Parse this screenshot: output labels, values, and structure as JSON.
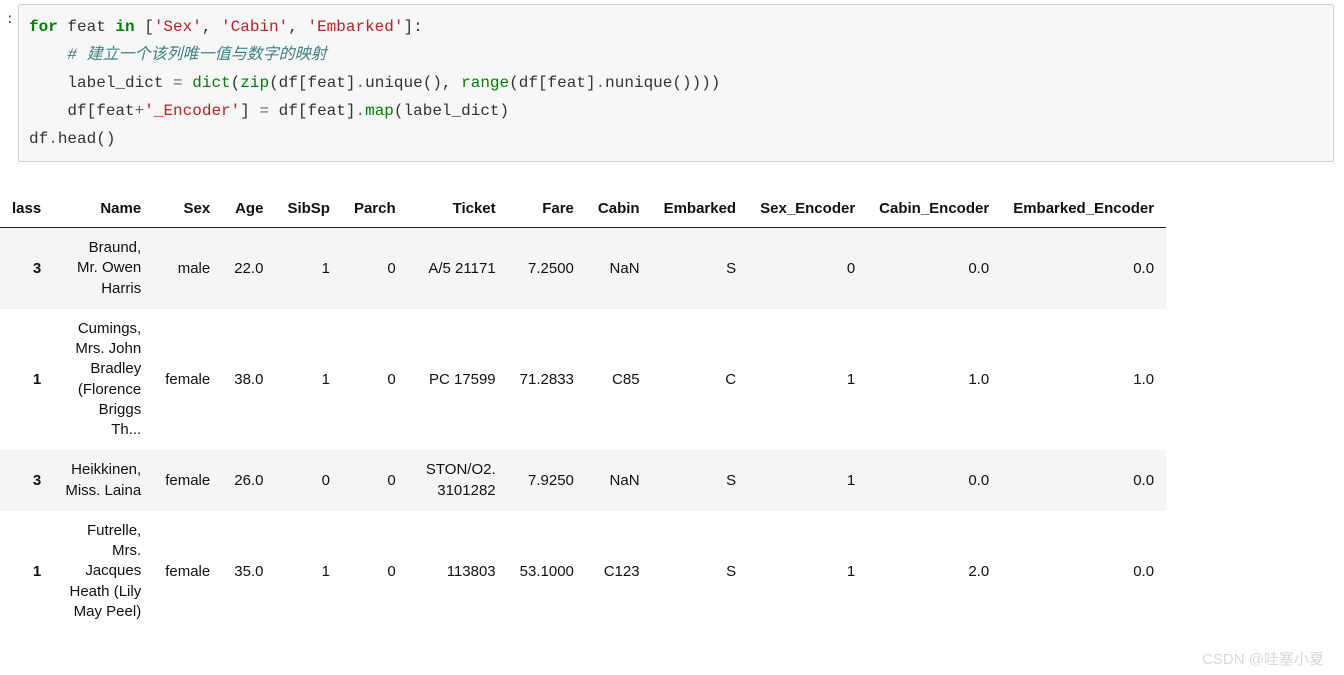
{
  "prompt": ":",
  "code": {
    "line1_for": "for",
    "line1_var": " feat ",
    "line1_in": "in",
    "line1_open": " [",
    "line1_s1": "'Sex'",
    "line1_c1": ", ",
    "line1_s2": "'Cabin'",
    "line1_c2": ", ",
    "line1_s3": "'Embarked'",
    "line1_close": "]:",
    "line2_indent": "    ",
    "line2_comment": "# 建立一个该列唯一值与数字的映射",
    "line3_indent": "    ",
    "line3_a": "label_dict ",
    "line3_eq": "=",
    "line3_b": " ",
    "line3_dict": "dict",
    "line3_p1": "(",
    "line3_zip": "zip",
    "line3_p2": "(df[feat]",
    "line3_dot1": ".",
    "line3_uniq": "unique(), ",
    "line3_range": "range",
    "line3_p3": "(df[feat]",
    "line3_dot2": ".",
    "line3_nun": "nunique())))",
    "line4_indent": "    ",
    "line4_a": "df[feat",
    "line4_plus": "+",
    "line4_str": "'_Encoder'",
    "line4_b": "] ",
    "line4_eq": "=",
    "line4_c": " df[feat]",
    "line4_dot": ".",
    "line4_map": "map",
    "line4_d": "(label_dict)",
    "line5_a": "df",
    "line5_dot": ".",
    "line5_head": "head",
    "line5_p": "()"
  },
  "table": {
    "headers": [
      "lass",
      "Name",
      "Sex",
      "Age",
      "SibSp",
      "Parch",
      "Ticket",
      "Fare",
      "Cabin",
      "Embarked",
      "Sex_Encoder",
      "Cabin_Encoder",
      "Embarked_Encoder"
    ],
    "rows": [
      {
        "lass": "3",
        "Name": "Braund, Mr. Owen Harris",
        "Sex": "male",
        "Age": "22.0",
        "SibSp": "1",
        "Parch": "0",
        "Ticket": "A/5 21171",
        "Fare": "7.2500",
        "Cabin": "NaN",
        "Embarked": "S",
        "Sex_Encoder": "0",
        "Cabin_Encoder": "0.0",
        "Embarked_Encoder": "0.0"
      },
      {
        "lass": "1",
        "Name": "Cumings, Mrs. John Bradley (Florence Briggs Th...",
        "Sex": "female",
        "Age": "38.0",
        "SibSp": "1",
        "Parch": "0",
        "Ticket": "PC 17599",
        "Fare": "71.2833",
        "Cabin": "C85",
        "Embarked": "C",
        "Sex_Encoder": "1",
        "Cabin_Encoder": "1.0",
        "Embarked_Encoder": "1.0"
      },
      {
        "lass": "3",
        "Name": "Heikkinen, Miss. Laina",
        "Sex": "female",
        "Age": "26.0",
        "SibSp": "0",
        "Parch": "0",
        "Ticket": "STON/O2. 3101282",
        "Fare": "7.9250",
        "Cabin": "NaN",
        "Embarked": "S",
        "Sex_Encoder": "1",
        "Cabin_Encoder": "0.0",
        "Embarked_Encoder": "0.0"
      },
      {
        "lass": "1",
        "Name": "Futrelle, Mrs. Jacques Heath (Lily May Peel)",
        "Sex": "female",
        "Age": "35.0",
        "SibSp": "1",
        "Parch": "0",
        "Ticket": "113803",
        "Fare": "53.1000",
        "Cabin": "C123",
        "Embarked": "S",
        "Sex_Encoder": "1",
        "Cabin_Encoder": "2.0",
        "Embarked_Encoder": "0.0"
      }
    ]
  },
  "watermark": "CSDN @哇塞小夏"
}
